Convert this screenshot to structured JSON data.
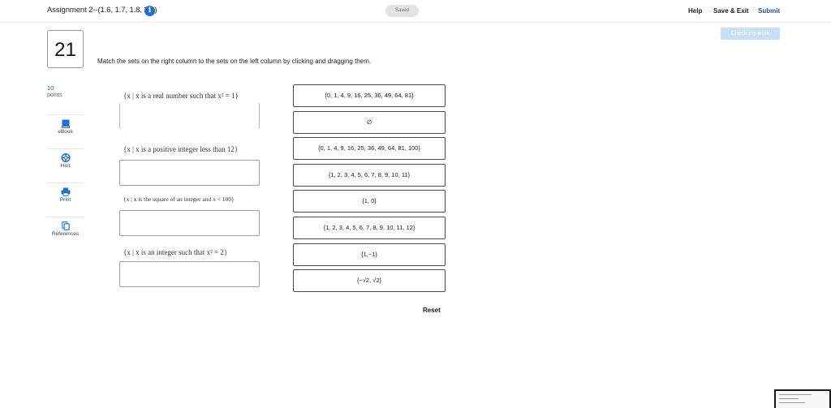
{
  "header": {
    "title": "Assignment 2--(1.6, 1.7, 1.8, 2.1)",
    "info_icon": "info-icon",
    "saved_label": "Saved",
    "help_label": "Help",
    "save_exit_label": "Save & Exit",
    "submit_label": "Submit"
  },
  "check_my_work_label": "Check my work",
  "question": {
    "number": "21",
    "points_value": "10",
    "points_label": "points",
    "instructions": "Match the sets on the right column to the sets on the left column by clicking and dragging them."
  },
  "tools": [
    {
      "label": "eBook",
      "icon": "book-icon"
    },
    {
      "label": "Hint",
      "icon": "lifebuoy-icon"
    },
    {
      "label": "Print",
      "icon": "printer-icon"
    },
    {
      "label": "References",
      "icon": "copy-icon"
    }
  ],
  "left_sets": [
    "{x | x is a real number such that x² = 1}",
    "{x | x is a positive integer less than 12}",
    "{x | x is the square of an integer and x < 100}",
    "{x | x is an integer such that x² = 2}"
  ],
  "right_sets": [
    "{0, 1, 4, 9, 16, 25, 36, 49, 64, 81}",
    "∅",
    "{0, 1, 4, 9, 16, 25, 36, 49, 64, 81, 100}",
    "{1, 2, 3, 4, 5, 6, 7, 8, 9, 10, 11}",
    "{1, 0}",
    "{1, 2, 3, 4, 5, 6, 7, 8, 9, 10, 11, 12}",
    "{1,−1}",
    "{−√2, √2}"
  ],
  "reset_label": "Reset",
  "colors": {
    "accent_blue": "#1f6fd1",
    "submit_blue": "#1a4fa3",
    "check_button_disabled": "#c9dff5"
  }
}
